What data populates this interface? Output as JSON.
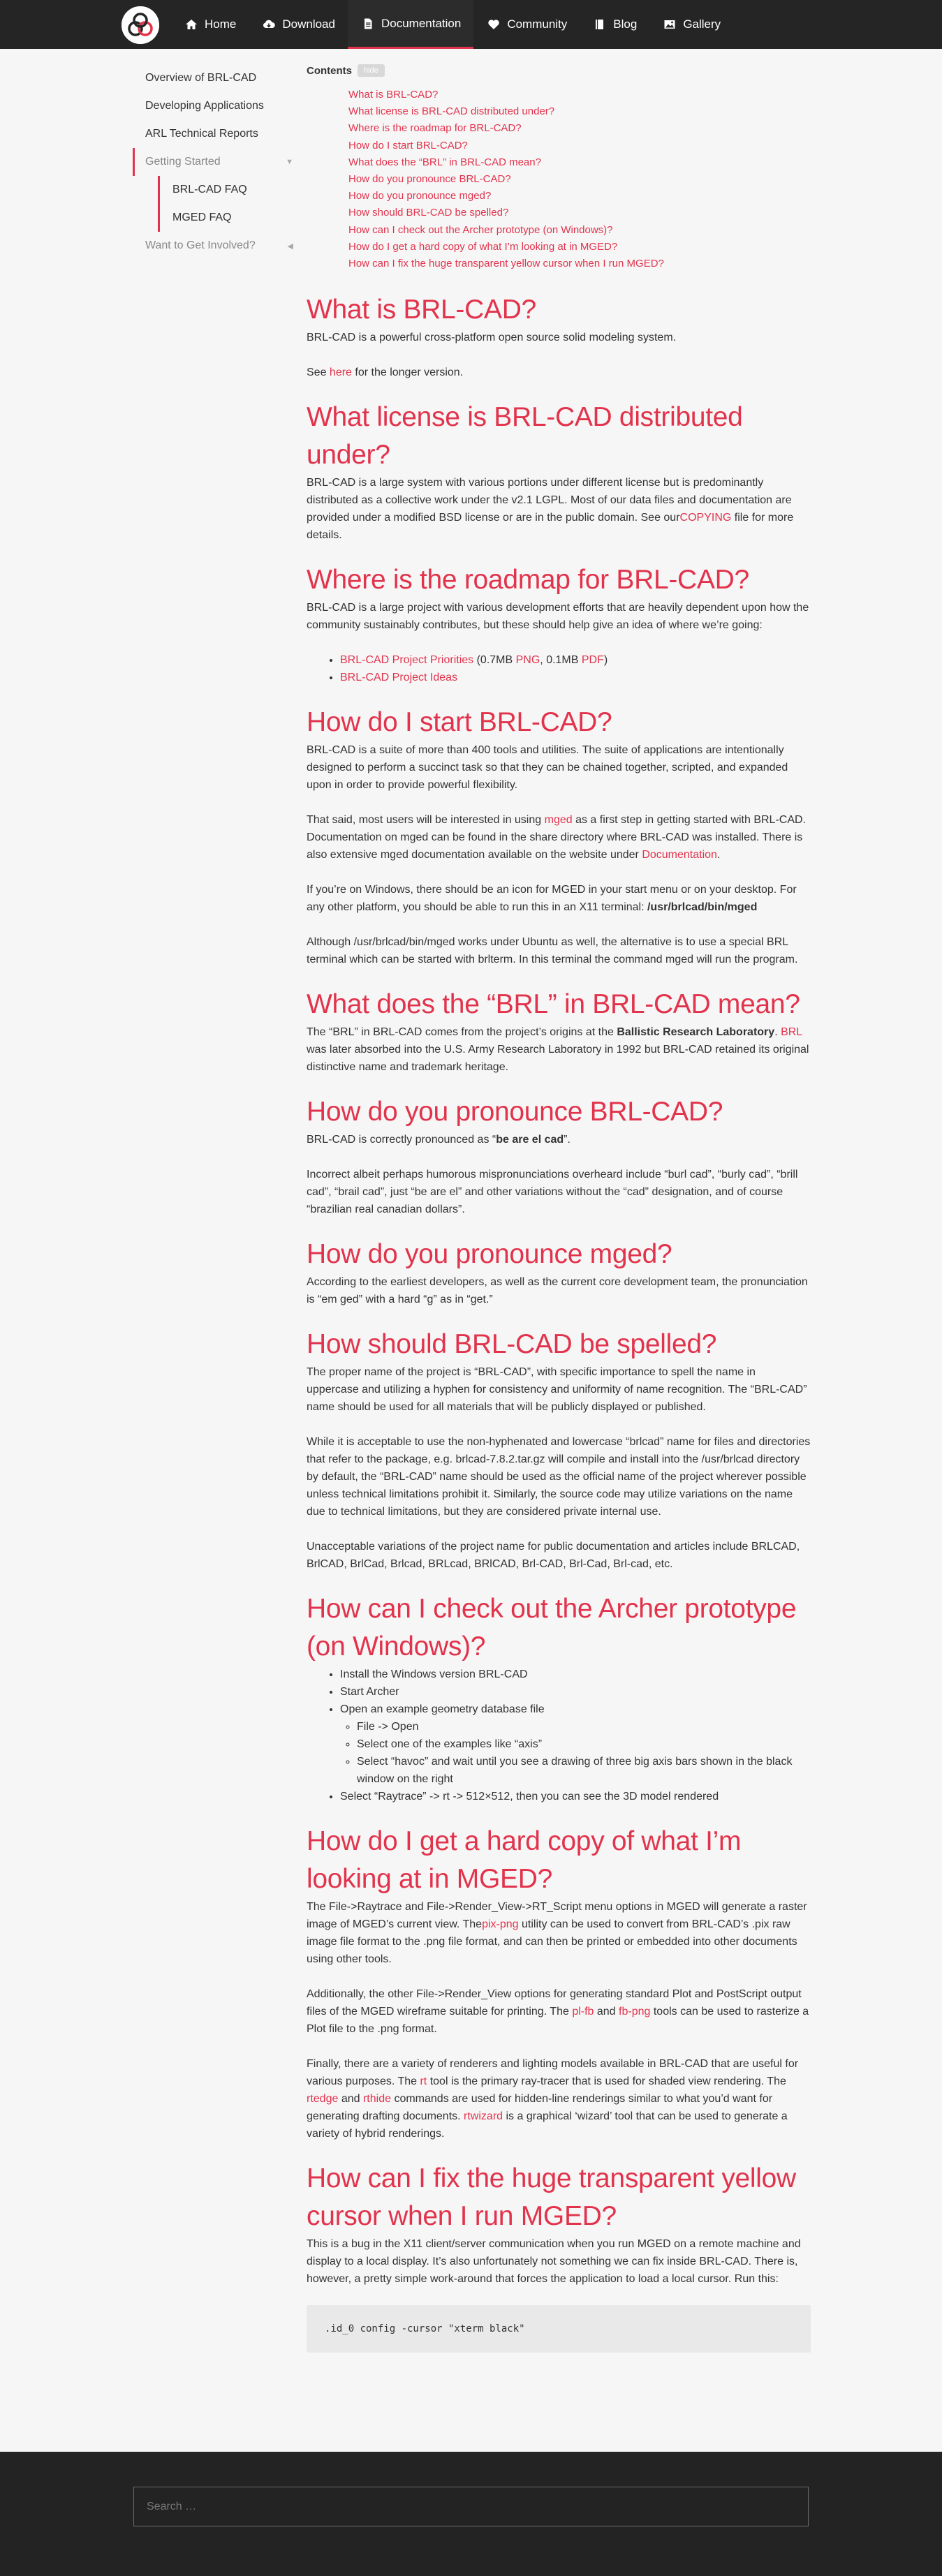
{
  "nav": [
    {
      "label": "Home",
      "icon": "home-icon"
    },
    {
      "label": "Download",
      "icon": "cloud-download-icon"
    },
    {
      "label": "Documentation",
      "icon": "document-icon"
    },
    {
      "label": "Community",
      "icon": "heart-icon"
    },
    {
      "label": "Blog",
      "icon": "book-icon"
    },
    {
      "label": "Gallery",
      "icon": "image-icon"
    }
  ],
  "sidebar": {
    "items": [
      {
        "label": "Overview of BRL-CAD"
      },
      {
        "label": "Developing Applications"
      },
      {
        "label": "ARL Technical Reports"
      },
      {
        "label": "Getting Started",
        "chevron": "▼"
      },
      {
        "label": "Want to Get Involved?",
        "chevron": "◀"
      }
    ],
    "subitems": [
      {
        "label": "BRL-CAD FAQ"
      },
      {
        "label": "MGED FAQ"
      }
    ]
  },
  "toc": {
    "heading": "Contents",
    "toggle": "hide",
    "items": [
      "What is BRL-CAD?",
      "What license is BRL-CAD distributed under?",
      "Where is the roadmap for BRL-CAD?",
      "How do I start BRL-CAD?",
      "What does the “BRL” in BRL-CAD mean?",
      "How do you pronounce BRL-CAD?",
      "How do you pronounce mged?",
      "How should BRL-CAD be spelled?",
      "How can I check out the Archer prototype (on Windows)?",
      "How do I get a hard copy of what I’m looking at in MGED?",
      "How can I fix the huge transparent yellow cursor when I run MGED?"
    ]
  },
  "s1": {
    "title": "What is BRL-CAD?",
    "p1": "BRL-CAD is a powerful cross-platform open source solid modeling system.",
    "p2a": "See ",
    "p2link": "here",
    "p2b": " for the longer version."
  },
  "s2": {
    "title": "What license is BRL-CAD distributed under?",
    "p1a": "BRL-CAD is a large system with various portions under different license but is predominantly distributed as a collective work under the v2.1 LGPL. Most of our data files and documentation are provided under a modified BSD license or are in the public domain. See our",
    "p1link": "COPYING",
    "p1b": " file for more details."
  },
  "s3": {
    "title": "Where is the roadmap for BRL-CAD?",
    "p1": "BRL-CAD is a large project with various development efforts that are heavily dependent upon how the community sustainably contributes, but these should help give an idea of where we’re going:",
    "li1link": "BRL-CAD Project Priorities",
    "li1a": " (0.7MB ",
    "li1png": "PNG",
    "li1b": ", 0.1MB ",
    "li1pdf": "PDF",
    "li1c": ")",
    "li2link": "BRL-CAD Project Ideas"
  },
  "s4": {
    "title": "How do I start BRL-CAD?",
    "p1": "BRL-CAD is a suite of more than 400 tools and utilities. The suite of applications are intentionally designed to perform a succinct task so that they can be chained together, scripted, and expanded upon in order to provide powerful flexibility.",
    "p2a": "That said, most users will be interested in using ",
    "p2link": "mged",
    "p2b": " as a first step in getting started with BRL-CAD. Documentation on mged can be found in the share directory where BRL-CAD was installed. There is also extensive mged documentation available on the website under ",
    "p2link2": "Documentation",
    "p2c": ".",
    "p3a": "If you’re on Windows, there should be an icon for MGED in your start menu or on your desktop. For any other platform, you should be able to run this in an X11 terminal: ",
    "p3bold": "/usr/brlcad/bin/mged",
    "p4": "Although /usr/brlcad/bin/mged works under Ubuntu as well, the alternative is to use a special BRL terminal which can be started with brlterm. In this terminal the command mged will run the program."
  },
  "s5": {
    "title": "What does the “BRL” in BRL-CAD mean?",
    "p1a": "The “BRL” in BRL-CAD comes from the project’s origins at the ",
    "p1bold": "Ballistic Research Laboratory",
    "p1b": ". ",
    "p1link": "BRL",
    "p1c": " was later absorbed into the U.S. Army Research Laboratory in 1992 but BRL-CAD retained its original distinctive name and trademark heritage."
  },
  "s6": {
    "title": "How do you pronounce BRL-CAD?",
    "p1a": "BRL-CAD is correctly pronounced as “",
    "p1bold": "be are el cad",
    "p1b": "”.",
    "p2": "Incorrect albeit perhaps humorous mispronunciations overheard include “burl cad”, “burly cad”, “brill cad”, “brail cad”, just “be are el” and other variations without the “cad” designation, and of course “brazilian real canadian dollars”."
  },
  "s7": {
    "title": "How do you pronounce mged?",
    "p1": "According to the earliest developers, as well as the current core development team, the pronunciation is “em ged” with a hard “g” as in “get.”"
  },
  "s8": {
    "title": "How should BRL-CAD be spelled?",
    "p1": "The proper name of the project is “BRL-CAD”, with specific importance to spell the name in uppercase and utilizing a hyphen for consistency and uniformity of name recognition. The “BRL-CAD” name should be used for all materials that will be publicly displayed or published.",
    "p2": "While it is acceptable to use the non-hyphenated and lowercase “brlcad” name for files and directories that refer to the package, e.g. brlcad-7.8.2.tar.gz will compile and install into the /usr/brlcad directory by default, the “BRL-CAD” name should be used as the official name of the project wherever possible unless technical limitations prohibit it. Similarly, the source code may utilize variations on the name due to technical limitations, but they are considered private internal use.",
    "p3": "Unacceptable variations of the project name for public documentation and articles include BRLCAD, BrlCAD, BrlCad, Brlcad, BRLcad, BRlCAD, Brl-CAD, Brl-Cad, Brl-cad, etc."
  },
  "s9": {
    "title": "How can I check out the Archer prototype (on Windows)?",
    "li1": "Install the Windows version BRL-CAD",
    "li2": "Start Archer",
    "li3": "Open an example geometry database file",
    "li3a": "File -> Open",
    "li3b": "Select one of the examples like “axis”",
    "li3c": "Select “havoc” and wait until you see a drawing of three big axis bars shown in the black window on the right",
    "li4": "Select “Raytrace” -> rt -> 512×512, then you can see the 3D model rendered"
  },
  "s10": {
    "title": "How do I get a hard copy of what I’m looking at in MGED?",
    "p1a": "The File->Raytrace and File->Render_View->RT_Script menu options in MGED will generate a raster image of MGED’s current view. The",
    "p1link": "pix-png",
    "p1b": " utility can be used to convert from BRL-CAD’s .pix raw image file format to the .png file format, and can then be printed or embedded into other documents using other tools.",
    "p2a": "Additionally, the other File->Render_View options for generating standard Plot and PostScript output files of the MGED wireframe suitable for printing. The ",
    "p2link1": "pl-fb",
    "p2and": " and ",
    "p2link2": "fb-png",
    "p2b": " tools can be used to rasterize a Plot file to the .png format.",
    "p3a": "Finally, there are a variety of renderers and lighting models available in BRL-CAD that are useful for various purposes. The ",
    "p3link1": "rt",
    "p3b": " tool is the primary ray-tracer that is used for shaded view rendering. The ",
    "p3link2": "rtedge",
    "p3and": " and ",
    "p3link3": "rthide",
    "p3c": " commands are used for hidden-line renderings similar to what you’d want for generating drafting documents. ",
    "p3link4": "rtwizard",
    "p3d": " is a graphical ‘wizard’ tool that can be used to generate a variety of hybrid renderings."
  },
  "s11": {
    "title": "How can I fix the huge transparent yellow cursor when I run MGED?",
    "p1": "This is a bug in the X11 client/server communication when you run MGED on a remote machine and display to a local display. It’s also unfortunately not something we can fix inside BRL-CAD. There is, however, a pretty simple work-around that forces the application to load a local cursor. Run this:",
    "code": ".id_0 config -cursor \"xterm black\""
  },
  "footer": {
    "search_placeholder": "Search …"
  },
  "colors": {
    "accent": "#e2334c",
    "header_bg": "#252525",
    "page_bg": "#f6f6f6",
    "footer_bg": "#232323"
  }
}
